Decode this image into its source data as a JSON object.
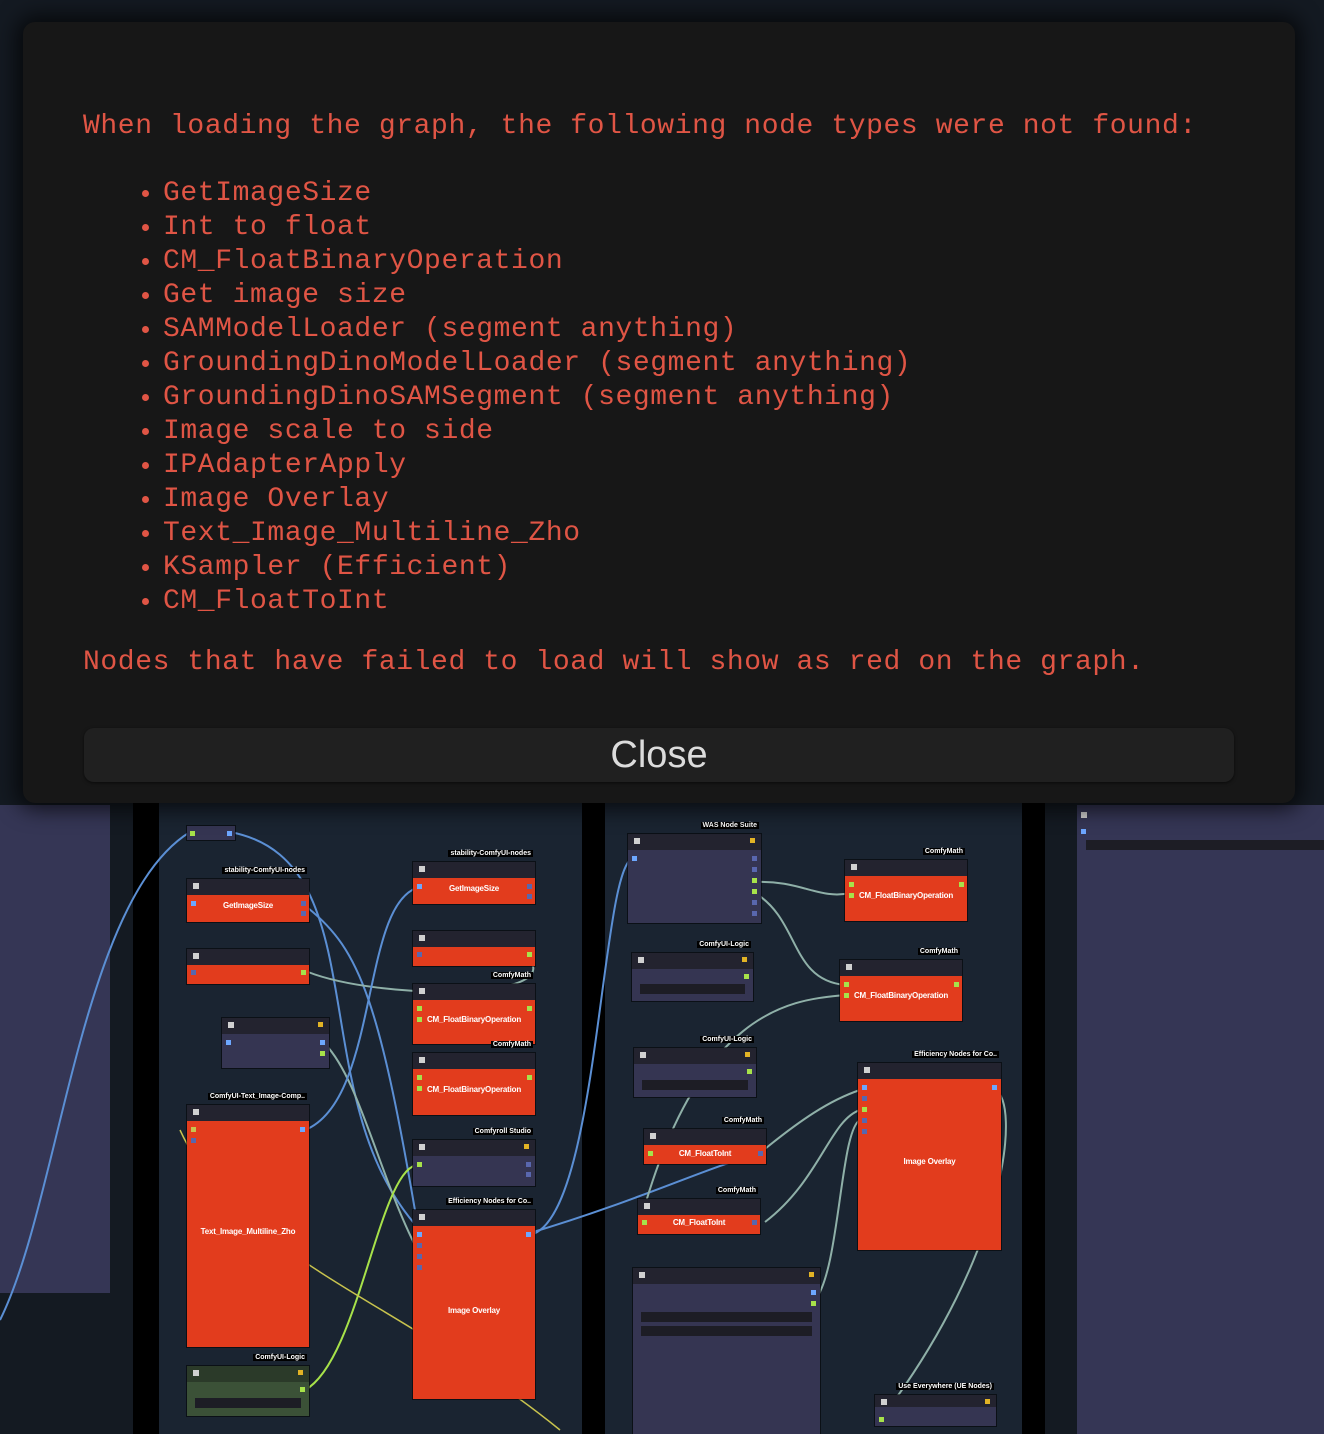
{
  "dialog": {
    "message": "When loading the graph, the following node types were not found:",
    "missing_nodes": [
      "GetImageSize",
      "Int to float",
      "CM_FloatBinaryOperation",
      "Get image size",
      "SAMModelLoader (segment anything)",
      "GroundingDinoModelLoader (segment anything)",
      "GroundingDinoSAMSegment (segment anything)",
      "Image scale to side",
      "IPAdapterApply",
      "Image Overlay",
      "Text_Image_Multiline_Zho",
      "KSampler (Efficient)",
      "CM_FloatToInt"
    ],
    "footer": "Nodes that have failed to load will show as red on the graph.",
    "close_label": "Close"
  },
  "graph": {
    "nodes": {
      "n1": {
        "pack": "stability-ComfyUI-nodes",
        "title": "GetImageSize"
      },
      "n2": {
        "pack": "stability-ComfyUI-nodes",
        "title": "GetImageSize"
      },
      "n3": {
        "pack": "ComfyMath",
        "title": "CM_FloatBinaryOperation"
      },
      "n4": {
        "pack": "ComfyMath",
        "title": "CM_FloatBinaryOperation"
      },
      "n5": {
        "pack": "Comfyroll Studio"
      },
      "n6": {
        "pack": "Efficiency Nodes for Co..",
        "title": "Image Overlay"
      },
      "n7": {
        "pack": "ComfyUI-Text_Image-Comp..",
        "title": "Text_Image_Multiline_Zho"
      },
      "n8": {
        "pack": "ComfyUI-Logic"
      },
      "n9": {
        "pack": "WAS Node Suite"
      },
      "n10": {
        "pack": "ComfyUI-Logic"
      },
      "n11": {
        "pack": "ComfyUI-Logic"
      },
      "n12": {
        "pack": "ComfyMath",
        "title": "CM_FloatToInt"
      },
      "n13": {
        "pack": "ComfyMath",
        "title": "CM_FloatToInt"
      },
      "n14": {
        "pack": "ComfyMath",
        "title": "CM_FloatBinaryOperation"
      },
      "n15": {
        "pack": "ComfyMath",
        "title": "CM_FloatBinaryOperation"
      },
      "n16": {
        "pack": "Efficiency Nodes for Co..",
        "title": "Image Overlay"
      },
      "n17": {
        "pack": "Use Everywhere (UE Nodes)"
      }
    }
  },
  "colors": {
    "error_text": "#e05545",
    "failed_node": "#e23c1d",
    "dialog_bg": "#171717"
  }
}
